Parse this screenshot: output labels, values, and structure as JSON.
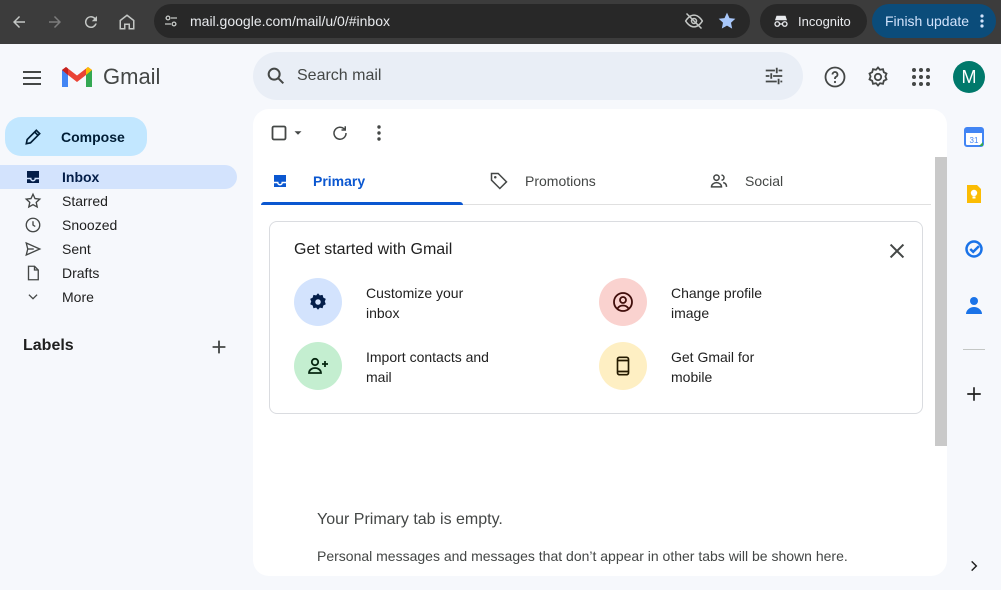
{
  "browser": {
    "url": "mail.google.com/mail/u/0/#inbox",
    "incognito_label": "Incognito",
    "finish_update_label": "Finish update"
  },
  "app": {
    "name": "Gmail",
    "search_placeholder": "Search mail",
    "avatar_letter": "M"
  },
  "compose_label": "Compose",
  "nav": {
    "items": [
      {
        "label": "Inbox",
        "icon": "inbox-icon"
      },
      {
        "label": "Starred",
        "icon": "star-icon"
      },
      {
        "label": "Snoozed",
        "icon": "clock-icon"
      },
      {
        "label": "Sent",
        "icon": "send-icon"
      },
      {
        "label": "Drafts",
        "icon": "draft-icon"
      },
      {
        "label": "More",
        "icon": "chevron-down-icon"
      }
    ],
    "labels_title": "Labels"
  },
  "tabs": [
    {
      "label": "Primary",
      "icon": "inbox-icon"
    },
    {
      "label": "Promotions",
      "icon": "tag-icon"
    },
    {
      "label": "Social",
      "icon": "people-icon"
    }
  ],
  "get_started": {
    "title": "Get started with Gmail",
    "items": [
      {
        "label": "Customize your inbox",
        "icon": "gear-icon",
        "color": "#d3e3fd"
      },
      {
        "label": "Change profile image",
        "icon": "account-circle-icon",
        "color": "#fad2cf"
      },
      {
        "label": "Import contacts and mail",
        "icon": "person-add-icon",
        "color": "#c4eed0"
      },
      {
        "label": "Get Gmail for mobile",
        "icon": "phone-icon",
        "color": "#feefc3"
      }
    ]
  },
  "empty_state": {
    "title": "Your Primary tab is empty.",
    "subtitle": "Personal messages and messages that don’t appear in other tabs will be shown here."
  },
  "colors": {
    "accent": "#0b57d0",
    "compose_bg": "#c2e7ff",
    "active_nav": "#d3e3fd",
    "avatar": "#00796b"
  }
}
